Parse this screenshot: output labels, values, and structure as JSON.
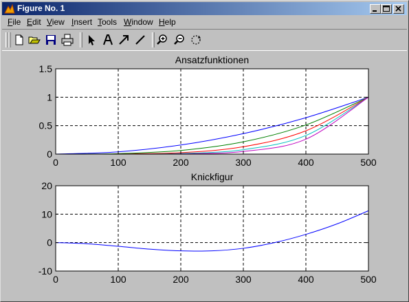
{
  "window": {
    "title": "Figure No. 1",
    "icon": "matlab-figure-icon",
    "controls": [
      "minimize",
      "maximize",
      "close"
    ]
  },
  "menu": [
    {
      "label": "File",
      "accel": "F",
      "rest": "ile"
    },
    {
      "label": "Edit",
      "accel": "E",
      "rest": "dit"
    },
    {
      "label": "View",
      "accel": "V",
      "rest": "iew"
    },
    {
      "label": "Insert",
      "accel": "I",
      "rest": "nsert"
    },
    {
      "label": "Tools",
      "accel": "T",
      "rest": "ools"
    },
    {
      "label": "Window",
      "accel": "W",
      "rest": "indow"
    },
    {
      "label": "Help",
      "accel": "H",
      "rest": "elp"
    }
  ],
  "toolbar": [
    {
      "icon": "new-file-icon"
    },
    {
      "icon": "open-folder-icon"
    },
    {
      "icon": "save-icon"
    },
    {
      "icon": "print-icon"
    },
    {
      "icon": "select-arrow-icon"
    },
    {
      "icon": "insert-text-icon"
    },
    {
      "icon": "insert-arrow-icon"
    },
    {
      "icon": "insert-line-icon"
    },
    {
      "icon": "zoom-in-icon"
    },
    {
      "icon": "zoom-out-icon"
    },
    {
      "icon": "rotate-3d-icon"
    }
  ],
  "chart_data": [
    {
      "type": "line",
      "title": "Ansatzfunktionen",
      "xlabel": "",
      "ylabel": "",
      "xlim": [
        0,
        500
      ],
      "ylim": [
        0,
        1.5
      ],
      "xticks": [
        0,
        100,
        200,
        300,
        400,
        500
      ],
      "yticks": [
        0,
        0.5,
        1,
        1.5
      ],
      "grid": true,
      "series": [
        {
          "color": "#0000ff",
          "x": [
            0,
            100,
            200,
            300,
            400,
            500
          ],
          "y": [
            0,
            0.04,
            0.16,
            0.36,
            0.64,
            1
          ]
        },
        {
          "color": "#008000",
          "x": [
            0,
            100,
            200,
            300,
            400,
            500
          ],
          "y": [
            0,
            0.008,
            0.064,
            0.216,
            0.512,
            1
          ]
        },
        {
          "color": "#ff0000",
          "x": [
            0,
            100,
            200,
            300,
            400,
            500
          ],
          "y": [
            0,
            0.0016,
            0.0256,
            0.1296,
            0.4096,
            1
          ]
        },
        {
          "color": "#00bfbf",
          "x": [
            0,
            100,
            200,
            300,
            400,
            500
          ],
          "y": [
            0,
            0.0003,
            0.0102,
            0.0778,
            0.3277,
            1
          ]
        },
        {
          "color": "#bf00bf",
          "x": [
            0,
            100,
            200,
            300,
            400,
            500
          ],
          "y": [
            0,
            0.0001,
            0.0041,
            0.0467,
            0.2621,
            1
          ]
        }
      ]
    },
    {
      "type": "line",
      "title": "Knickfigur",
      "xlabel": "",
      "ylabel": "",
      "xlim": [
        0,
        500
      ],
      "ylim": [
        -10,
        20
      ],
      "xticks": [
        0,
        100,
        200,
        300,
        400,
        500
      ],
      "yticks": [
        -10,
        0,
        10,
        20
      ],
      "grid": true,
      "series": [
        {
          "color": "#0000ff",
          "x": [
            0,
            50,
            100,
            150,
            200,
            250,
            300,
            350,
            400,
            450,
            500
          ],
          "y": [
            0,
            -0.4,
            -1.3,
            -2.3,
            -2.9,
            -2.9,
            -2.0,
            0.0,
            2.9,
            6.6,
            11.2
          ]
        }
      ]
    }
  ]
}
